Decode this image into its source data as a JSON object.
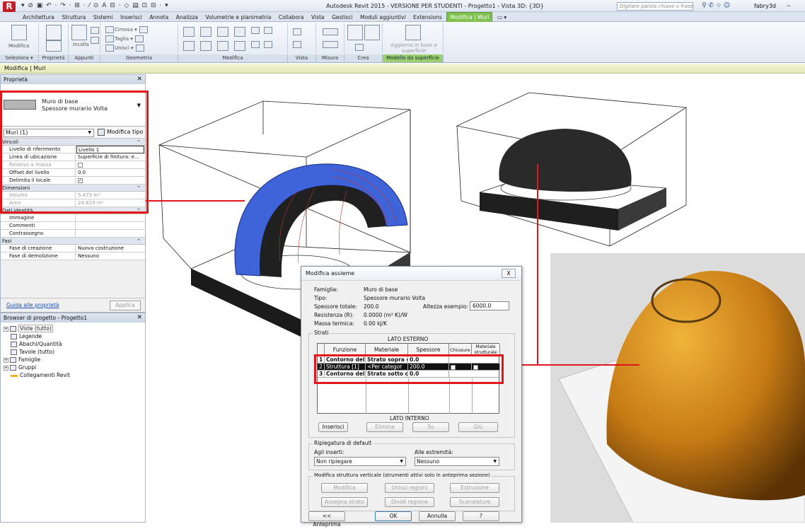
{
  "titlebar": {
    "logo": "R",
    "window_title": "Autodesk Revit 2015 - VERSIONE PER STUDENTI -   Progetto1 - Vista 3D: {3D}",
    "search_placeholder": "Digitare parola chiave o frase",
    "user": "fabry3d"
  },
  "tabs": [
    "Architettura",
    "Struttura",
    "Sistemi",
    "Inserisci",
    "Annota",
    "Analizza",
    "Volumetrie e planimetria",
    "Collabora",
    "Vista",
    "Gestisci",
    "Moduli aggiuntivi",
    "Extensions",
    "Modifica | Muri"
  ],
  "ribbon": {
    "panels": [
      "Seleziona ▾",
      "Proprietà",
      "Appunti",
      "Geometria",
      "Modifica",
      "Vista",
      "Misura",
      "Crea",
      "Modello da superficie"
    ],
    "modifica_label": "Modifica",
    "incolla_label": "Incolla",
    "cimosa": "Cimosa",
    "taglia": "Taglia",
    "unisci": "Unisci",
    "aggiorna": "Aggiorna in base a superficie"
  },
  "options_bar": "Modifica | Muri",
  "properties": {
    "title": "Proprietà",
    "type_line1": "Muro di base",
    "type_line2": "Spessore murario Volta",
    "instance_selector": "Muri (1)",
    "edit_type": "Modifica tipo",
    "groups": {
      "vincoli": "Vincoli",
      "dimensioni": "Dimensioni",
      "dati": "Dati identità",
      "fasi": "Fasi"
    },
    "rows_vincoli": [
      {
        "k": "Livello di riferimento",
        "v": "Livello 1"
      },
      {
        "k": "Linea di ubicazione",
        "v": "Superficie di finitura: e..."
      },
      {
        "k": "Relativo a massa",
        "v": ""
      },
      {
        "k": "Offset del livello",
        "v": "0.0"
      },
      {
        "k": "Delimita il locale",
        "v": ""
      }
    ],
    "rows_dimensioni": [
      {
        "k": "Volume",
        "v": "5.473 m³"
      },
      {
        "k": "Area",
        "v": "24.819 m²"
      }
    ],
    "rows_dati": [
      {
        "k": "Immagine",
        "v": ""
      },
      {
        "k": "Commenti",
        "v": ""
      },
      {
        "k": "Contrassegno",
        "v": ""
      }
    ],
    "rows_fasi": [
      {
        "k": "Fase di creazione",
        "v": "Nuova costruzione"
      },
      {
        "k": "Fase di demolizione",
        "v": "Nessuno"
      }
    ],
    "guide_link": "Guida alle proprietà",
    "apply": "Applica"
  },
  "browser": {
    "title": "Browser di progetto - Progetto1",
    "items": [
      "Viste (tutto)",
      "Legende",
      "Abachi/Quantità",
      "Tavole (tutto)",
      "Famiglie",
      "Gruppi",
      "Collegamenti Revit"
    ]
  },
  "dialog": {
    "title": "Modifica assieme",
    "close": "X",
    "famiglia_l": "Famiglia:",
    "famiglia_v": "Muro di base",
    "tipo_l": "Tipo:",
    "tipo_v": "Spessore murario Volta",
    "spessore_l": "Spessore totale:",
    "spessore_v": "200.0",
    "resist_l": "Resistenza (R):",
    "resist_v": "0.0000 (m²·K)/W",
    "massa_l": "Massa termica:",
    "massa_v": "0.00 kJ/K",
    "altezza_l": "Altezza esempio:",
    "altezza_v": "6000.0",
    "strati": "Strati",
    "lato_esterno": "LATO ESTERNO",
    "lato_interno": "LATO INTERNO",
    "headers": [
      "Funzione",
      "Materiale",
      "Spessore",
      "Chiusure",
      "Materiale strutturale"
    ],
    "layers": [
      {
        "n": "1",
        "f": "Contorno del n",
        "m": "Strato sopra c",
        "s": "0.0"
      },
      {
        "n": "2",
        "f": "Struttura [1]",
        "m": "<Per categor",
        "s": "200.0"
      },
      {
        "n": "3",
        "f": "Contorno del n",
        "m": "Strato sotto c",
        "s": "0.0"
      }
    ],
    "btn_inserisci": "Inserisci",
    "btn_elimina": "Elimina",
    "btn_su": "Su",
    "btn_giu": "Giù",
    "ripiegatura": "Ripiegatura di default",
    "agli_inserti": "Agli inserti:",
    "agli_inserti_v": "Non ripiegare",
    "alle_estremita": "Alle estremità:",
    "alle_estremita_v": "Nessuno",
    "vert_title": "Modifica struttura verticale (strumenti attivi solo in anteprima sezione)",
    "btn_modifica": "Modifica",
    "btn_unisci": "Unisci regioni",
    "btn_estrusione": "Estrusione",
    "btn_assegna": "Assegna strato",
    "btn_dividi": "Dividi regione",
    "btn_scanalature": "Scanalature",
    "btn_anteprima": "<< Anteprima",
    "btn_ok": "OK",
    "btn_annulla": "Annulla",
    "btn_help": "?"
  },
  "colors": {
    "accent_red": "#e0161b",
    "dome_blue": "#3f63d8",
    "context_tab": "#7fc24f"
  }
}
